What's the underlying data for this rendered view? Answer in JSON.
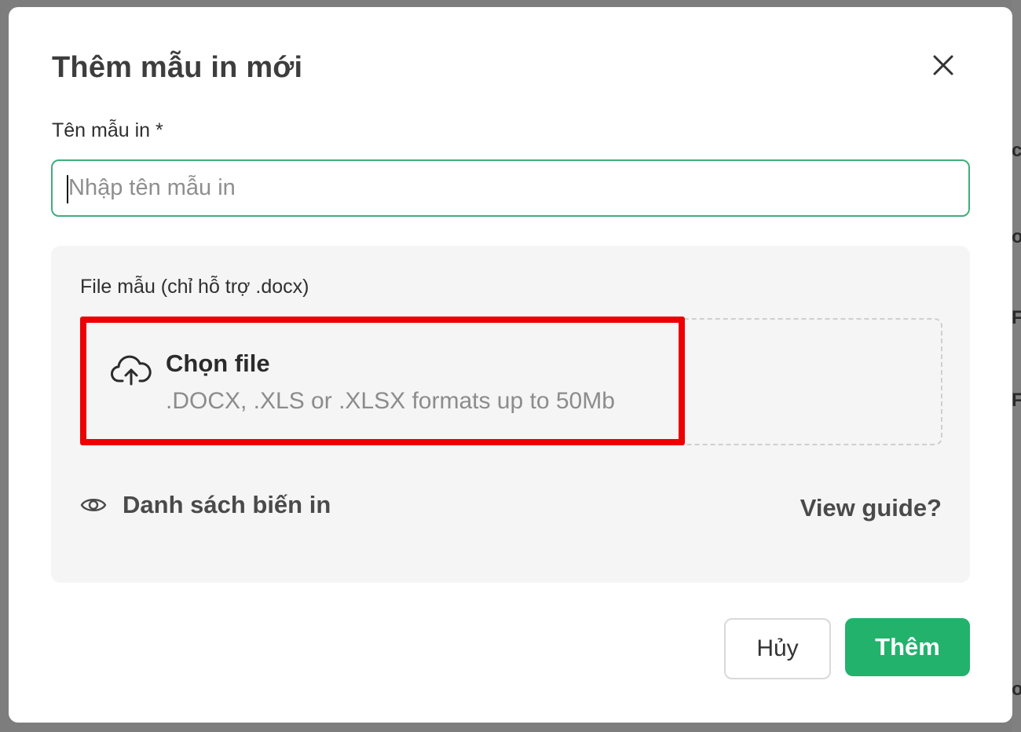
{
  "dialog": {
    "title": "Thêm mẫu in mới",
    "close_icon": "close-icon"
  },
  "name_field": {
    "label": "Tên mẫu in *",
    "value": "",
    "placeholder": "Nhập tên mẫu in"
  },
  "file_section": {
    "label": "File mẫu (chỉ hỗ trợ .docx)",
    "upload_icon": "cloud-upload-icon",
    "choose_label": "Chọn file",
    "formats_hint": ".DOCX, .XLS or .XLSX formats up to 50Mb",
    "variables_icon": "eye-icon",
    "variables_label": "Danh sách biến in",
    "guide_link": "View guide?"
  },
  "footer": {
    "cancel_label": "Hủy",
    "submit_label": "Thêm"
  },
  "colors": {
    "primary": "#22b26c",
    "input_focus_border": "#3fae7c",
    "highlight": "#ee0000",
    "overlay": "#7d7d7d"
  }
}
